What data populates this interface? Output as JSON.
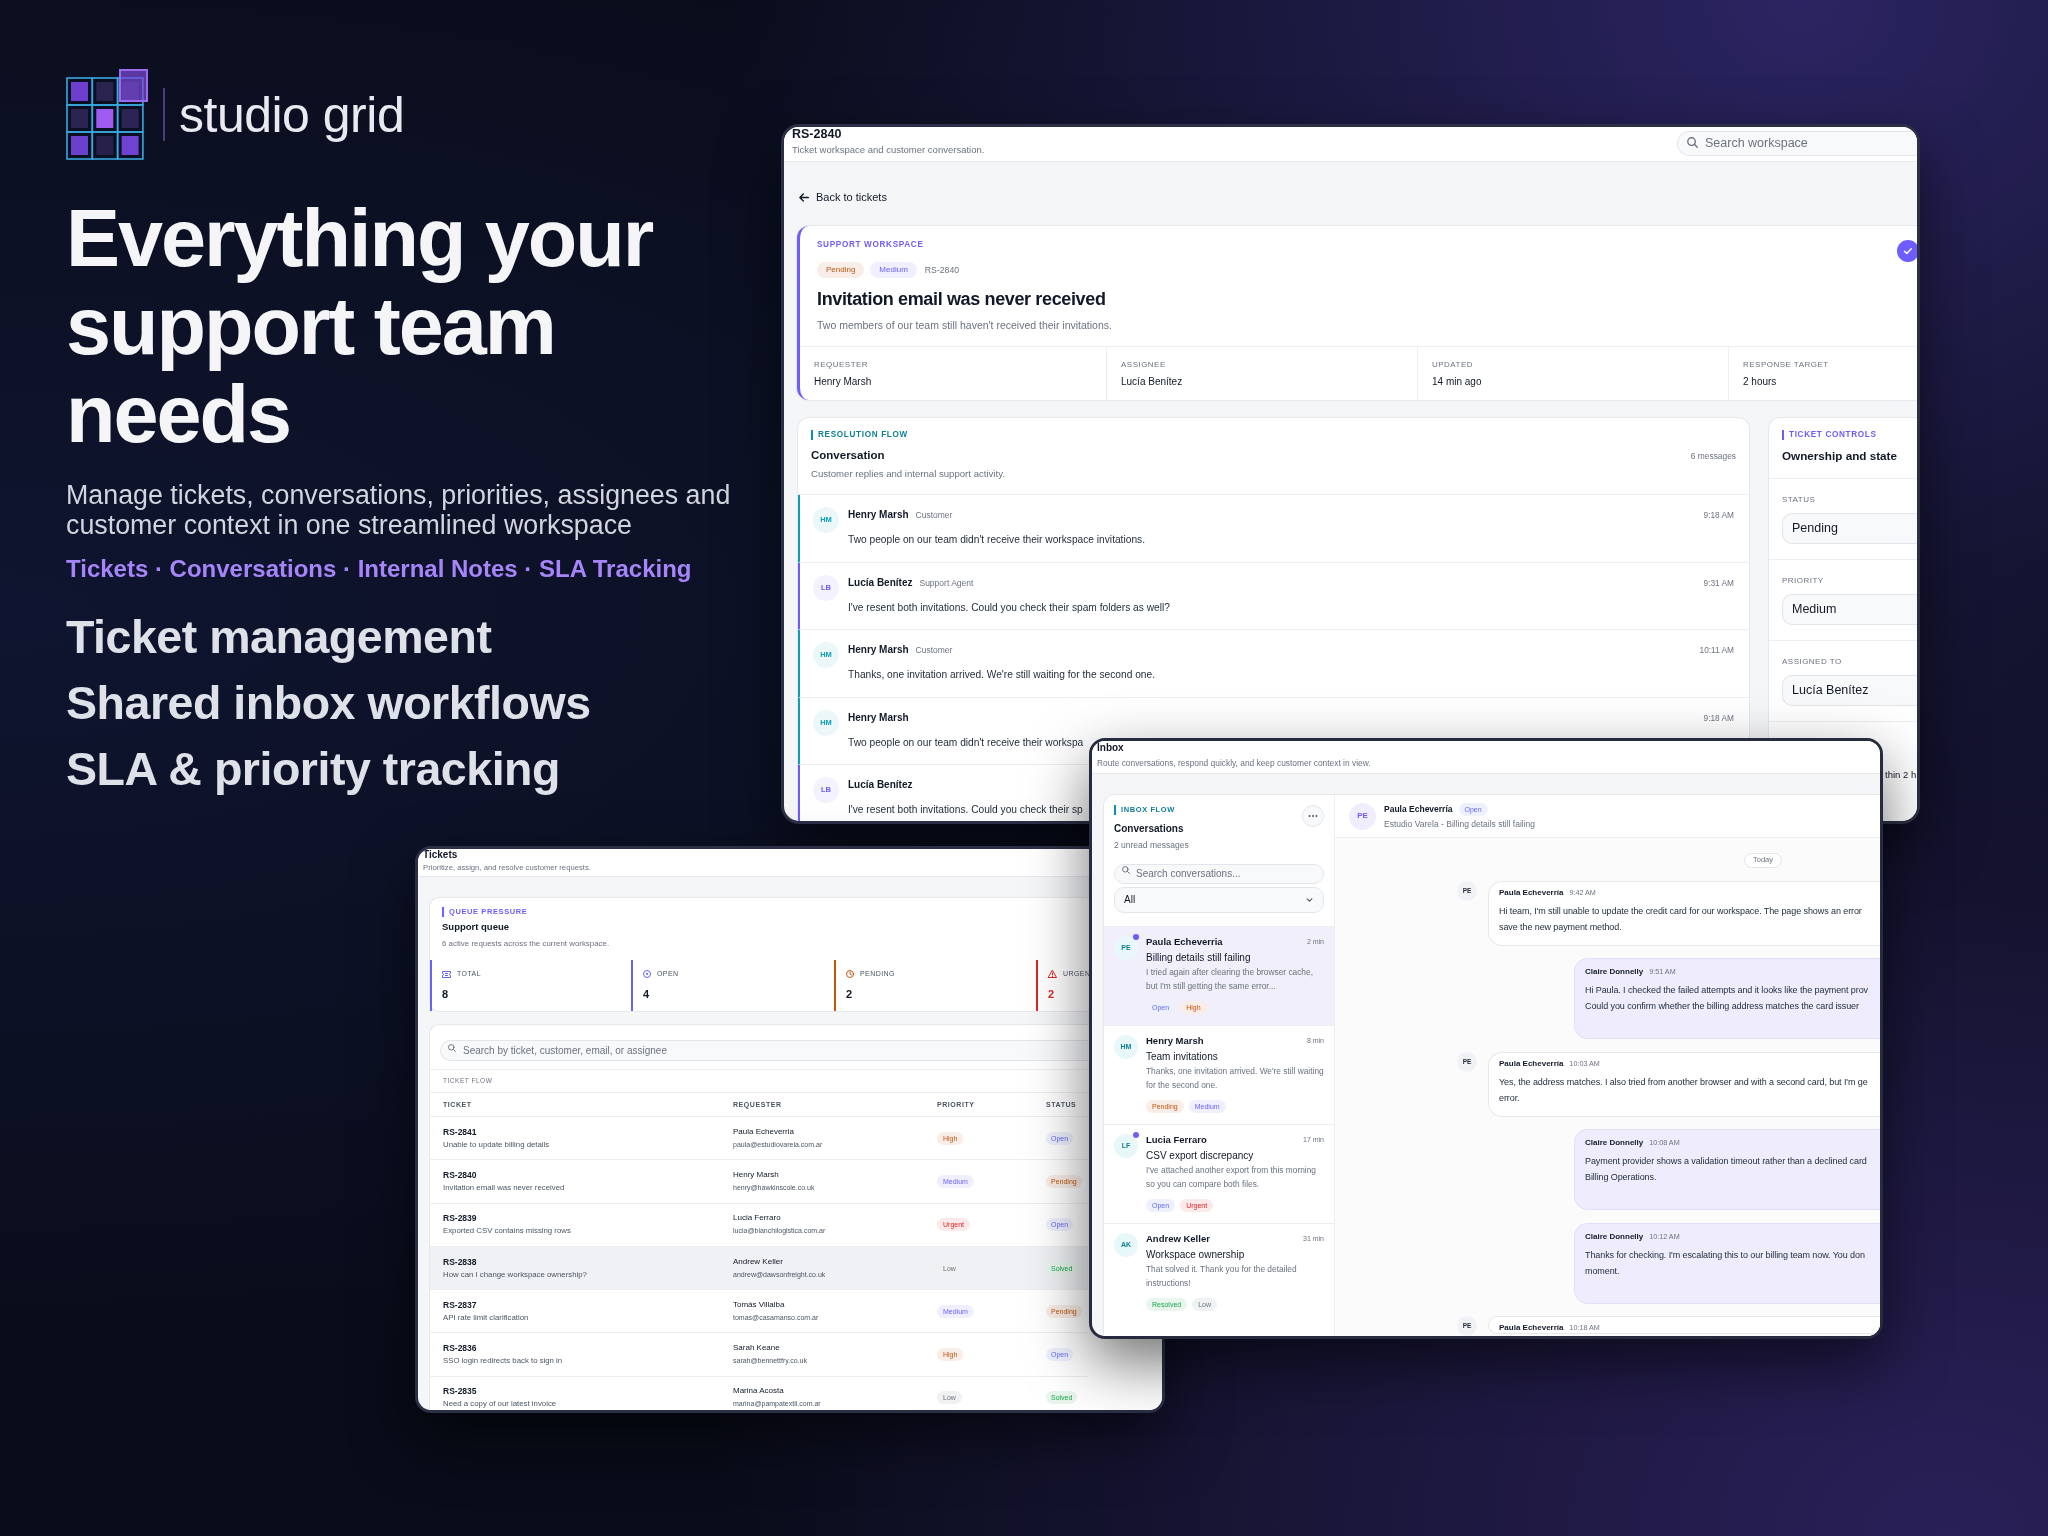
{
  "brand": {
    "name": "studio grid"
  },
  "hero": {
    "headline": "Everything your support team needs",
    "subtitle": "Manage tickets, conversations, priorities, assignees and customer context in one streamlined workspace",
    "tagline": "Tickets · Conversations · Internal Notes · SLA Tracking",
    "features": [
      "Ticket management",
      "Shared inbox workflows",
      "SLA & priority tracking"
    ]
  },
  "ticket_window": {
    "title": "RS-2840",
    "subtitle": "Ticket workspace and customer conversation.",
    "search": {
      "placeholder": "Search workspace"
    },
    "back_link": "Back to tickets",
    "ticket": {
      "eyebrow": "SUPPORT WORKSPACE",
      "badges": [
        {
          "text": "Pending",
          "color": "#f9eee7"
        },
        {
          "text": "Medium",
          "color": "#f0efff"
        }
      ],
      "id": "RS-2840",
      "title": "Invitation email was never received",
      "description": "Two members of our team still haven't received their invitations.",
      "fields": [
        {
          "label": "REQUESTER",
          "value": "Henry Marsh"
        },
        {
          "label": "ASSIGNEE",
          "value": "Lucía Benítez"
        },
        {
          "label": "UPDATED",
          "value": "14 min ago"
        },
        {
          "label": "RESPONSE TARGET",
          "value": "2 hours"
        }
      ]
    },
    "conversation": {
      "eyebrow": "RESOLUTION FLOW",
      "title": "Conversation",
      "count": "6 messages",
      "description": "Customer replies and internal support activity.",
      "messages": [
        {
          "initials": "HM",
          "author": "Henry Marsh",
          "role": "Customer",
          "time": "9:18 AM",
          "text": "Two people on our team didn't receive their workspace invitations.",
          "color": "#0e9fb5"
        },
        {
          "initials": "LB",
          "author": "Lucía Benítez",
          "role": "Support Agent",
          "time": "9:31 AM",
          "text": "I've resent both invitations. Could you check their spam folders as well?",
          "color": "#6d5dfc"
        },
        {
          "initials": "HM",
          "author": "Henry Marsh",
          "role": "Customer",
          "time": "10:11 AM",
          "text": "Thanks, one invitation arrived. We're still waiting for the second one.",
          "color": "#0e9fb5"
        },
        {
          "initials": "HM",
          "author": "Henry Marsh",
          "time": "9:18 AM",
          "text": "Two people on our team didn't receive their workspa",
          "color": "#0e9fb5"
        },
        {
          "initials": "LB",
          "author": "Lucía Benítez",
          "text": "I've resent both invitations. Could you check their sp",
          "color": "#6d5dfc"
        }
      ]
    },
    "controls": {
      "eyebrow": "TICKET CONTROLS",
      "title": "Ownership and state",
      "fields": [
        {
          "label": "STATUS",
          "value": "Pending"
        },
        {
          "label": "PRIORITY",
          "value": "Medium"
        },
        {
          "label": "ASSIGNED TO",
          "value": "Lucía Benítez"
        }
      ],
      "note": "thin 2 h"
    }
  },
  "tickets_window": {
    "title": "Tickets",
    "subtitle": "Prioritize, assign, and resolve customer requests.",
    "queue": {
      "eyebrow": "QUEUE PRESSURE",
      "title": "Support queue",
      "description": "6 active requests across the current workspace.",
      "stats": [
        {
          "label": "TOTAL",
          "value": "8",
          "color": "#6366f1",
          "alert": false
        },
        {
          "label": "OPEN",
          "value": "4",
          "color": "#6366f1",
          "alert": false
        },
        {
          "label": "PENDING",
          "value": "2",
          "color": "#c2570c",
          "alert": false
        },
        {
          "label": "URGEN",
          "value": "2",
          "color": "#dc2626",
          "alert": true
        }
      ]
    },
    "search": {
      "placeholder": "Search by ticket, customer, email, or assignee"
    },
    "table": {
      "caption": "TICKET FLOW",
      "columns": [
        "TICKET",
        "REQUESTER",
        "PRIORITY",
        "STATUS"
      ],
      "rows": [
        {
          "id": "RS-2841",
          "subject": "Unable to update billing details",
          "requester": "Paula Echeverria",
          "email": "paula@estudiovarela.com.ar",
          "priority": {
            "text": "High",
            "color": "#f9eee7"
          },
          "status": {
            "text": "Open",
            "color": "#eff0fe"
          },
          "selected": false
        },
        {
          "id": "RS-2840",
          "subject": "Invitation email was never received",
          "requester": "Henry Marsh",
          "email": "henry@hawkinscole.co.uk",
          "priority": {
            "text": "Medium",
            "color": "#f0efff"
          },
          "status": {
            "text": "Pending",
            "color": "#f9eee7"
          },
          "selected": false
        },
        {
          "id": "RS-2839",
          "subject": "Exported CSV contains missing rows",
          "requester": "Lucia Ferraro",
          "email": "lucia@bianchilogistica.com.ar",
          "priority": {
            "text": "Urgent",
            "color": "#fce9e9"
          },
          "status": {
            "text": "Open",
            "color": "#eff0fe"
          },
          "selected": false
        },
        {
          "id": "RS-2838",
          "subject": "How can I change workspace ownership?",
          "requester": "Andrew Keller",
          "email": "andrew@dawsonfreight.co.uk",
          "priority": {
            "text": "Low",
            "color": "#f0f1f2"
          },
          "status": {
            "text": "Solved",
            "color": "#e8f6ed"
          },
          "selected": true
        },
        {
          "id": "RS-2837",
          "subject": "API rate limit clarification",
          "requester": "Tomás Villalba",
          "email": "tomas@casamanso.com.ar",
          "priority": {
            "text": "Medium",
            "color": "#f0efff"
          },
          "status": {
            "text": "Pending",
            "color": "#f9eee7"
          },
          "selected": false
        },
        {
          "id": "RS-2836",
          "subject": "SSO login redirects back to sign in",
          "requester": "Sarah Keane",
          "email": "sarah@bennettfry.co.uk",
          "priority": {
            "text": "High",
            "color": "#f9eee7"
          },
          "status": {
            "text": "Open",
            "color": "#eff0fe"
          },
          "selected": false
        },
        {
          "id": "RS-2835",
          "subject": "Need a copy of our latest invoice",
          "requester": "Marina Acosta",
          "email": "marina@pampatextil.com.ar",
          "priority": {
            "text": "Low",
            "color": "#f0f1f2"
          },
          "status": {
            "text": "Solved",
            "color": "#e8f6ed"
          },
          "selected": false
        }
      ]
    }
  },
  "inbox_window": {
    "title": "Inbox",
    "subtitle": "Route conversations, respond quickly, and keep customer context in view.",
    "list": {
      "eyebrow": "INBOX FLOW",
      "title": "Conversations",
      "unread_count": "2 unread messages",
      "search": {
        "placeholder": "Search conversations..."
      },
      "filter": {
        "value": "All"
      },
      "items": [
        {
          "initials": "PE",
          "unread": true,
          "name": "Paula Echeverria",
          "time": "2 min",
          "subject": "Billing details still failing",
          "preview": "I tried again after clearing the browser cache, but I'm still getting the same error...",
          "tags": [
            {
              "text": "Open",
              "color": "#eff0fe"
            },
            {
              "text": "High",
              "color": "#f9eee7"
            }
          ],
          "selected": true
        },
        {
          "initials": "HM",
          "unread": false,
          "name": "Henry Marsh",
          "time": "8 min",
          "subject": "Team invitations",
          "preview": "Thanks, one invitation arrived. We're still waiting for the second one.",
          "tags": [
            {
              "text": "Pending",
              "color": "#f9eee7"
            },
            {
              "text": "Medium",
              "color": "#f0efff"
            }
          ],
          "selected": false
        },
        {
          "initials": "LF",
          "unread": true,
          "name": "Lucia Ferraro",
          "time": "17 min",
          "subject": "CSV export discrepancy",
          "preview": "I've attached another export from this morning so you can compare both files.",
          "tags": [
            {
              "text": "Open",
              "color": "#eff0fe"
            },
            {
              "text": "Urgent",
              "color": "#fce9e9"
            }
          ],
          "selected": false
        },
        {
          "initials": "AK",
          "unread": false,
          "name": "Andrew Keller",
          "time": "31 min",
          "subject": "Workspace ownership",
          "preview": "That solved it. Thank you for the detailed instructions!",
          "tags": [
            {
              "text": "Resolved",
              "color": "#e8f6ed"
            },
            {
              "text": "Low",
              "color": "#f0f1f2"
            }
          ],
          "selected": false
        }
      ]
    },
    "chat": {
      "initials": "PE",
      "name": "Paula Echeverría",
      "status": {
        "text": "Open",
        "color": "#eff0fe"
      },
      "context": "Estudio Varela - Billing details still failing",
      "day": "Today",
      "messages": [
        {
          "kind": "customer",
          "initials": "PE",
          "author": "Paula Echeverría",
          "time": "9:42 AM",
          "lines": [
            "Hi team, I'm still unable to update the credit card for our workspace. The page shows an error",
            "save the new payment method."
          ]
        },
        {
          "kind": "agent",
          "author": "Claire Donnelly",
          "time": "9:51 AM",
          "lines": [
            "Hi Paula. I checked the failed attempts and it looks like the payment prov",
            "Could you confirm whether the billing address matches the card issuer"
          ]
        },
        {
          "kind": "customer",
          "initials": "PE",
          "author": "Paula Echeverría",
          "time": "10:03 AM",
          "lines": [
            "Yes, the address matches. I also tried from another browser and with a second card, but I'm ge",
            "error."
          ]
        },
        {
          "kind": "agent",
          "author": "Claire Donnelly",
          "time": "10:08 AM",
          "lines": [
            "Payment provider shows a validation timeout rather than a declined card",
            "Billing Operations."
          ]
        },
        {
          "kind": "agent",
          "author": "Claire Donnelly",
          "time": "10:12 AM",
          "lines": [
            "Thanks for checking. I'm escalating this to our billing team now. You don",
            "moment."
          ]
        },
        {
          "kind": "customer",
          "initials": "PE",
          "author": "Paula Echeverría",
          "time": "10:18 AM"
        }
      ]
    }
  }
}
